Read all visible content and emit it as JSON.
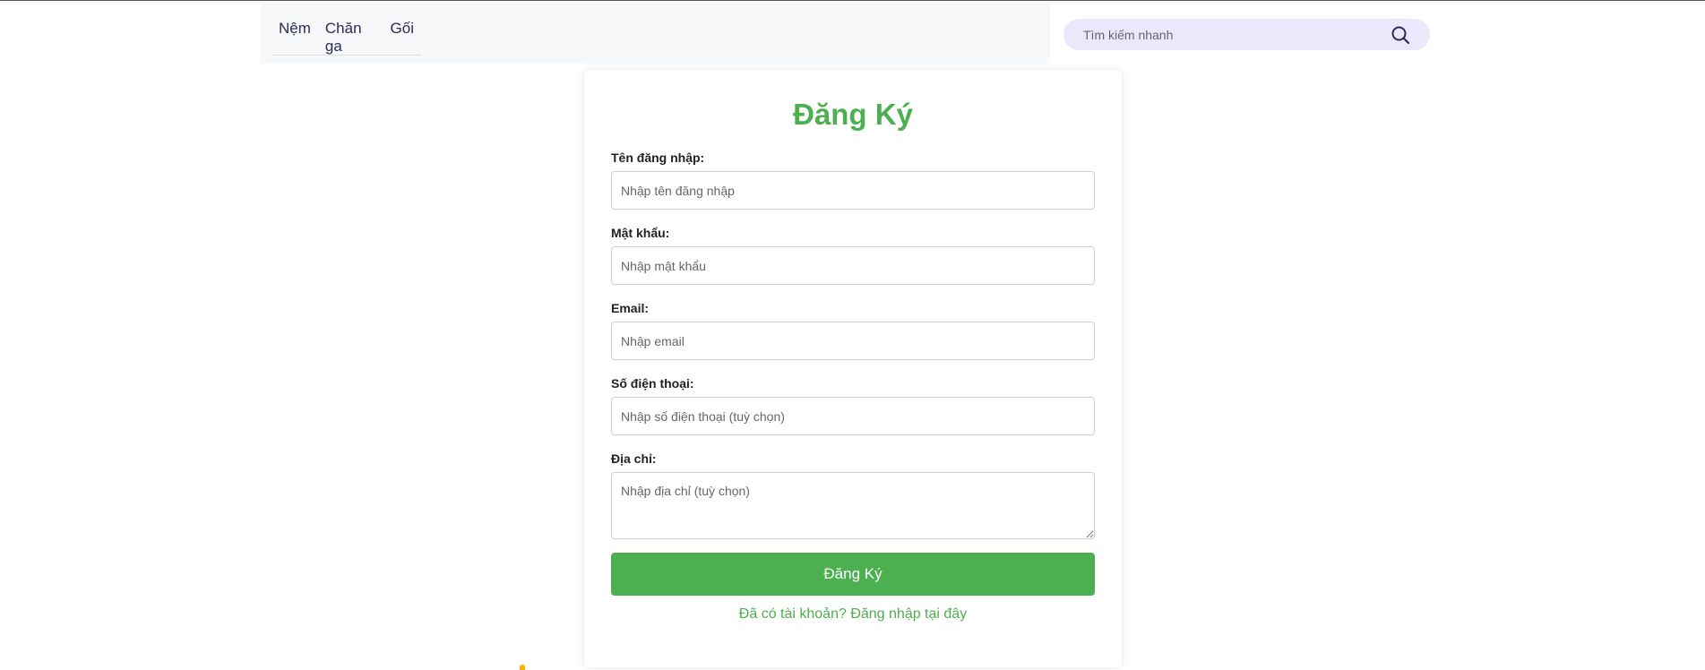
{
  "nav": {
    "items": [
      {
        "label": "Nệm"
      },
      {
        "label": "Chăn ga"
      },
      {
        "label": "Gối"
      }
    ]
  },
  "search": {
    "placeholder": "Tìm kiếm nhanh",
    "icon": "search-icon"
  },
  "form": {
    "title": "Đăng Ký",
    "fields": {
      "username": {
        "label": "Tên đăng nhập:",
        "placeholder": "Nhập tên đăng nhập",
        "value": ""
      },
      "password": {
        "label": "Mật khẩu:",
        "placeholder": "Nhập mật khẩu",
        "value": ""
      },
      "email": {
        "label": "Email:",
        "placeholder": "Nhập email",
        "value": ""
      },
      "phone": {
        "label": "Số điện thoại:",
        "placeholder": "Nhập số điện thoại (tuỳ chọn)",
        "value": ""
      },
      "address": {
        "label": "Địa chỉ:",
        "placeholder": "Nhập địa chỉ (tuỳ chọn)",
        "value": ""
      }
    },
    "submit_label": "Đăng Ký",
    "login_link": "Đã có tài khoản? Đăng nhập tại đây"
  },
  "colors": {
    "accent": "#4caf50",
    "nav_text": "#2b2b5a",
    "search_bg": "#ebe8fb"
  }
}
